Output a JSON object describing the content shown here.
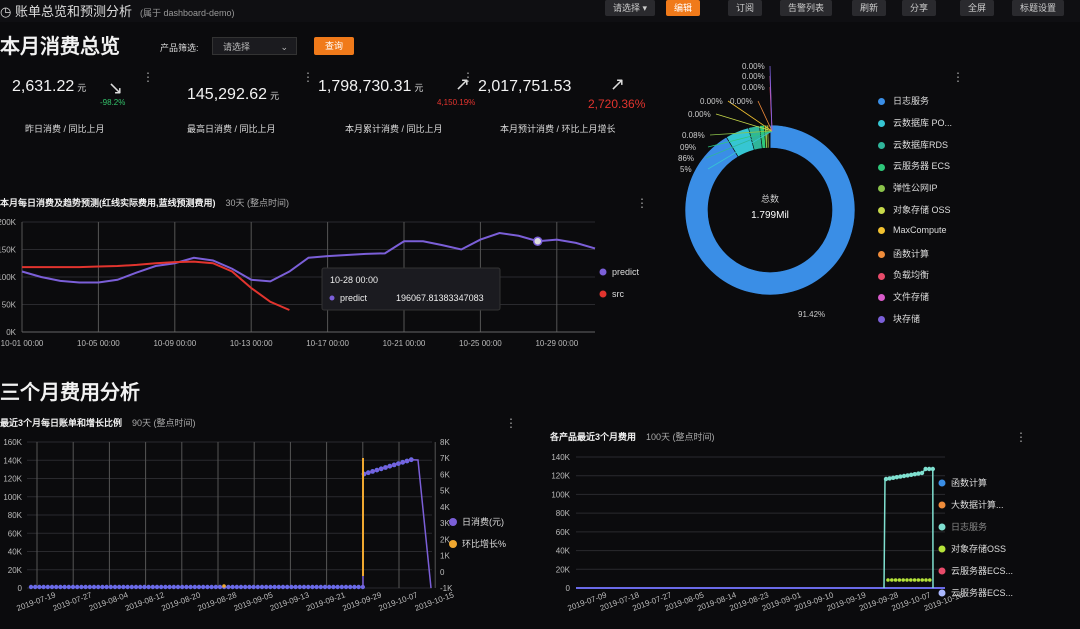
{
  "header": {
    "title": "账单总览和预测分析",
    "subtitle": "(属于 dashboard-demo)",
    "buttons": [
      "请选择 ▾",
      "编辑",
      "订阅",
      "告警列表",
      "刷新",
      "分享",
      "全屏",
      "标题设置"
    ]
  },
  "section1": {
    "title": "本月消费总览"
  },
  "filter": {
    "label": "产品筛选:",
    "placeholder": "请选择",
    "query_label": "查询"
  },
  "kpis": [
    {
      "value": "2,631.22",
      "unit": "元",
      "change": "-98.2%",
      "change_color": "#34c26a",
      "label": "昨日消费 / 同比上月",
      "arrow": "↘"
    },
    {
      "value": "145,292.62",
      "unit": "元",
      "change": "",
      "change_color": "#34c26a",
      "label": "最高日消费 / 同比上月",
      "arrow": ""
    },
    {
      "value": "1,798,730.31",
      "unit": "元",
      "change": "4,150.19%",
      "change_color": "#e2342e",
      "label": "本月累计消费 / 同比上月",
      "arrow": "↗"
    },
    {
      "value": "2,017,751.53",
      "unit": "",
      "change": "2,720.36%",
      "change_color": "#e2342e",
      "label": "本月预计消费 / 环比上月增长",
      "arrow": "↗"
    }
  ],
  "colors": {
    "accent": "#f07a1a",
    "predict": "#7b5fd8",
    "src": "#e2342e",
    "blue": "#3a8ee6"
  },
  "chart_data": [
    {
      "type": "line",
      "title": "本月每日消费及趋势预测(红线实际费用,蓝线预测费用)",
      "subtitle": "30天 (整点时间)",
      "x_ticks": [
        "10-01 00:00",
        "10-05 00:00",
        "10-09 00:00",
        "10-13 00:00",
        "10-17 00:00",
        "10-21 00:00",
        "10-25 00:00",
        "10-29 00:00"
      ],
      "y_ticks": [
        "0K",
        "50K",
        "100K",
        "150K",
        "200K"
      ],
      "ylim": [
        0,
        200000
      ],
      "series": [
        {
          "name": "predict",
          "color": "#7b5fd8",
          "x": [
            1,
            2,
            3,
            4,
            5,
            6,
            7,
            8,
            9,
            10,
            11,
            12,
            13,
            14,
            15,
            16,
            17,
            18,
            19,
            20,
            21,
            22,
            23,
            24,
            25,
            26,
            27,
            28,
            29,
            30,
            31
          ],
          "values": [
            110000,
            100000,
            93000,
            90000,
            90000,
            95000,
            108000,
            120000,
            125000,
            135000,
            130000,
            115000,
            95000,
            92000,
            110000,
            135000,
            138000,
            140000,
            142000,
            143000,
            165000,
            165000,
            158000,
            150000,
            168000,
            180000,
            175000,
            165000,
            168000,
            162000,
            152000
          ]
        },
        {
          "name": "src",
          "color": "#e2342e",
          "x": [
            1,
            2,
            3,
            4,
            5,
            6,
            7,
            8,
            9,
            10,
            11,
            12,
            13,
            14,
            15
          ],
          "values": [
            118000,
            118000,
            118000,
            118000,
            119000,
            120000,
            122000,
            125000,
            127000,
            128000,
            125000,
            110000,
            80000,
            55000,
            40000
          ]
        }
      ],
      "tooltip": {
        "header": "10-28 00:00",
        "series": "predict",
        "value": "196067.81383347083"
      }
    },
    {
      "type": "pie",
      "center_label": "总数",
      "center_value": "1.799Mil",
      "slices": [
        {
          "name": "日志服务",
          "value": 91.42,
          "color": "#3a8ee6"
        },
        {
          "name": "云数据库 PO...",
          "value": 4.5,
          "color": "#36c6d3"
        },
        {
          "name": "云数据库RDS",
          "value": 2.1,
          "color": "#2fb59a"
        },
        {
          "name": "云服务器 ECS",
          "value": 0.9,
          "color": "#2ec87a"
        },
        {
          "name": "弹性公网IP",
          "value": 0.5,
          "color": "#8bc34a"
        },
        {
          "name": "对象存储 OSS",
          "value": 0.3,
          "color": "#c7d94a"
        },
        {
          "name": "MaxCompute",
          "value": 0.15,
          "color": "#f2c230"
        },
        {
          "name": "函数计算",
          "value": 0.08,
          "color": "#f08c3a"
        },
        {
          "name": "负载均衡",
          "value": 0.03,
          "color": "#e84b6a"
        },
        {
          "name": "文件存储",
          "value": 0.01,
          "color": "#d95bc9"
        },
        {
          "name": "块存储",
          "value": 0.01,
          "color": "#7b5fd8"
        }
      ],
      "slice_labels": [
        "91.42%",
        "5%",
        "86%",
        "09%",
        "0.08%",
        "0.00%",
        "0.00%",
        "0.00%",
        "0.00%",
        "0.00%",
        "0.00%"
      ]
    },
    {
      "type": "line",
      "title": "最近3个月每日账单和增长比例",
      "subtitle": "90天 (整点时间)",
      "x_ticks": [
        "2019-07-19",
        "2019-07-27",
        "2019-08-04",
        "2019-08-12",
        "2019-08-20",
        "2019-08-28",
        "2019-09-05",
        "2019-09-13",
        "2019-09-21",
        "2019-09-29",
        "2019-10-07",
        "2019-10-15"
      ],
      "y_ticks": [
        "0",
        "20K",
        "40K",
        "60K",
        "80K",
        "100K",
        "120K",
        "140K",
        "160K"
      ],
      "y2_ticks": [
        "-1K",
        "0",
        "1K",
        "2K",
        "3K",
        "4K",
        "5K",
        "6K",
        "7K",
        "8K"
      ],
      "series": [
        {
          "name": "日消费(元)",
          "color": "#7b5fd8",
          "kind": "points"
        },
        {
          "name": "环比增长%",
          "color": "#f0a830",
          "kind": "line"
        }
      ]
    },
    {
      "type": "line",
      "title": "各产品最近3个月费用",
      "subtitle": "100天 (整点时间)",
      "x_ticks": [
        "2019-07-09",
        "2019-07-18",
        "2019-07-27",
        "2019-08-05",
        "2019-08-14",
        "2019-08-23",
        "2019-09-01",
        "2019-09-10",
        "2019-09-19",
        "2019-09-28",
        "2019-10-07",
        "2019-10-16"
      ],
      "y_ticks": [
        "0",
        "20K",
        "40K",
        "60K",
        "80K",
        "100K",
        "120K",
        "140K"
      ],
      "series": [
        {
          "name": "函数计算",
          "color": "#3a8ee6"
        },
        {
          "name": "大数据计算...",
          "color": "#f08c3a"
        },
        {
          "name": "日志服务",
          "color": "#7fe0d0"
        },
        {
          "name": "对象存储OSS",
          "color": "#b5e33a"
        },
        {
          "name": "云服务器ECS...",
          "color": "#e84b6a"
        },
        {
          "name": "云服务器ECS...",
          "color": "#aab8ff"
        }
      ]
    }
  ],
  "section2": {
    "title": "三个月费用分析"
  }
}
